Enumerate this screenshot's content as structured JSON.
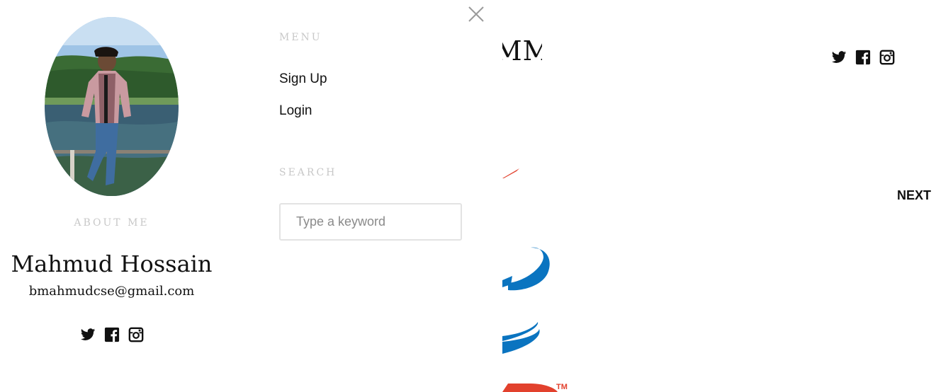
{
  "page": {
    "brand_text": "PROGRAMMING DATA",
    "next_label": "NEXT",
    "social_icons": [
      "twitter-icon",
      "facebook-icon",
      "instagram-icon"
    ]
  },
  "overlay": {
    "close_icon": "close-icon",
    "avatar_icon": "profile-photo",
    "about_label": "ABOUT ME",
    "author_name": "Mahmud Hossain",
    "author_email": "bmahmudcse@gmail.com",
    "social_icons": [
      "twitter-icon",
      "facebook-icon",
      "instagram-icon"
    ],
    "menu": {
      "heading": "MENU",
      "items": [
        {
          "label": "Sign Up"
        },
        {
          "label": "Login"
        }
      ]
    },
    "search": {
      "heading": "SEARCH",
      "placeholder": "Type a keyword",
      "value": ""
    }
  },
  "colors": {
    "text": "#111111",
    "muted_heading": "#c8c8c8",
    "input_border": "#e3e3e3",
    "placeholder": "#8a8a8a",
    "art_red": "#e2412d",
    "art_blue": "#0a74c0"
  }
}
